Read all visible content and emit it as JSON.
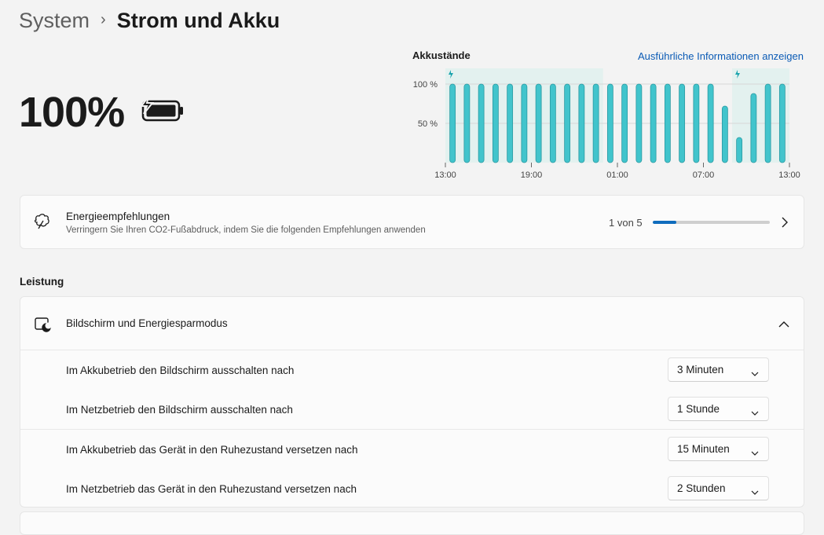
{
  "breadcrumb": {
    "parent": "System",
    "separator": "›",
    "current": "Strom und Akku"
  },
  "battery": {
    "percent": "100%",
    "charging": true,
    "level": 1.0
  },
  "chart": {
    "title": "Akkustände",
    "link": "Ausführliche Informationen anzeigen"
  },
  "chart_data": {
    "type": "bar",
    "title": "Akkustände",
    "y_ticks": [
      "100 %",
      "50 %"
    ],
    "ylim": [
      0,
      100
    ],
    "x_ticks": [
      "13:00",
      "19:00",
      "01:00",
      "07:00",
      "13:00"
    ],
    "values": [
      100,
      100,
      100,
      100,
      100,
      100,
      100,
      100,
      100,
      100,
      100,
      100,
      100,
      100,
      100,
      100,
      100,
      100,
      100,
      72,
      32,
      88,
      100,
      100
    ],
    "charging_periods": [
      [
        0,
        10
      ],
      [
        20,
        23
      ]
    ],
    "bar_color": "#41c4cc",
    "charging_band_color": "#e3f1ef",
    "grid": true
  },
  "energy": {
    "title": "Energieempfehlungen",
    "subtitle": "Verringern Sie Ihren CO2-Fußabdruck, indem Sie die folgenden Empfehlungen anwenden",
    "progress_text": "1 von 5",
    "progress_fraction": 0.2,
    "progress_color": "#0f6cbd"
  },
  "section": {
    "title": "Leistung"
  },
  "screen": {
    "title": "Bildschirm und Energiesparmodus",
    "settings": [
      {
        "label": "Im Akkubetrieb den Bildschirm ausschalten nach",
        "value": "3 Minuten"
      },
      {
        "label": "Im Netzbetrieb den Bildschirm ausschalten nach",
        "value": "1 Stunde"
      },
      {
        "label": "Im Akkubetrieb das Gerät in den Ruhezustand versetzen nach",
        "value": "15 Minuten"
      },
      {
        "label": "Im Netzbetrieb das Gerät in den Ruhezustand versetzen nach",
        "value": "2 Stunden"
      }
    ]
  },
  "icons": {
    "chevron": "chevron-right-icon",
    "battery": "battery-charging-icon",
    "leaf": "leaf-icon",
    "screen": "screen-sleep-icon",
    "dropdown": "chevron-down-icon"
  }
}
